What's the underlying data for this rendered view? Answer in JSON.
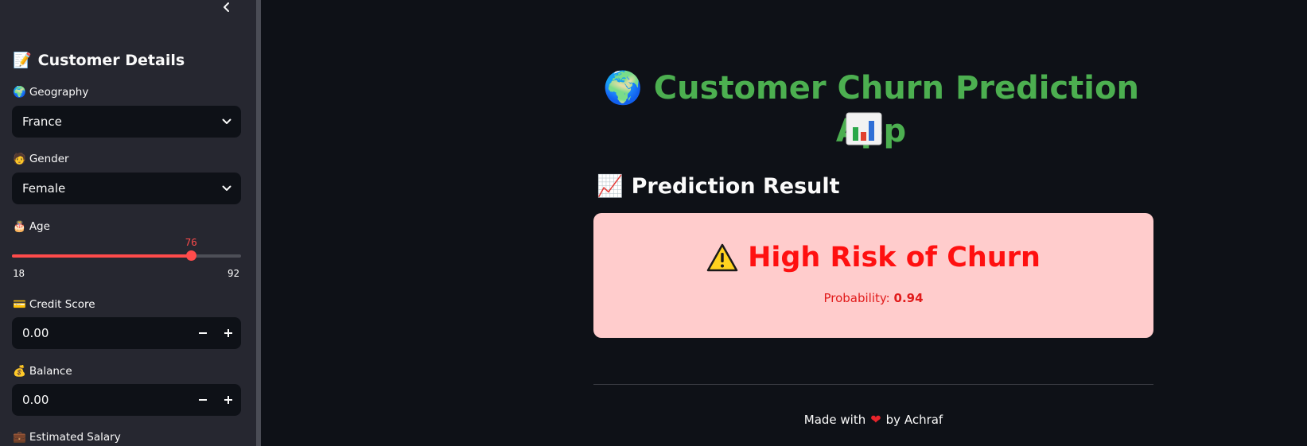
{
  "sidebar": {
    "heading": "Customer Details",
    "heading_emoji": "📝",
    "fields": {
      "geography": {
        "label": "Geography",
        "emoji": "🌍",
        "value": "France"
      },
      "gender": {
        "label": "Gender",
        "emoji": "🧑",
        "value": "Female"
      },
      "age": {
        "label": "Age",
        "emoji": "🎂",
        "value": "76",
        "min": "18",
        "max": "92",
        "fraction": 0.784
      },
      "credit_score": {
        "label": "Credit Score",
        "emoji": "💳",
        "value": "0.00"
      },
      "balance": {
        "label": "Balance",
        "emoji": "💰",
        "value": "0.00"
      },
      "estimated_salary": {
        "label": "Estimated Salary",
        "emoji": "💼"
      }
    }
  },
  "main": {
    "title": "Customer Churn Prediction App",
    "title_emoji": "🌍",
    "section_heading": "Prediction Result",
    "section_emoji": "📈",
    "result": {
      "icon": "⚠",
      "title": "High Risk of Churn",
      "probability_label": "Probability:",
      "probability_value": "0.94"
    },
    "footer": {
      "prefix": "Made with",
      "heart": "❤",
      "suffix": "by Achraf"
    }
  },
  "colors": {
    "accent": "#ff4b4b",
    "title_green": "#4caf50",
    "result_bg": "#ffcccc",
    "result_text": "#ff1010"
  }
}
